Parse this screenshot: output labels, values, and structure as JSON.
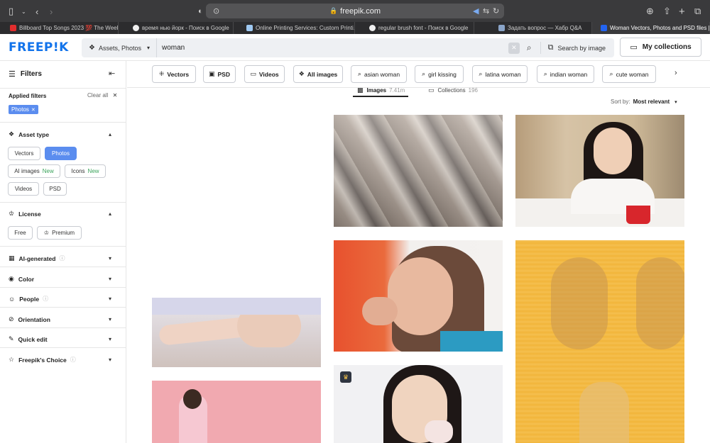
{
  "browser": {
    "url": "freepik.com",
    "tabs": [
      {
        "title": "Billboard Top Songs 2023 💯 The Week...",
        "favicon": "#e12d2d"
      },
      {
        "title": "время нью йорк - Поиск в Google",
        "favicon": "#e8e8e8"
      },
      {
        "title": "Online Printing Services: Custom Printi...",
        "favicon": "#9fc9f2"
      },
      {
        "title": "regular brush font - Поиск в Google",
        "favicon": "#e8e8e8"
      },
      {
        "title": "Задать вопрос — Хабр Q&A",
        "favicon": "#8aa4c8"
      },
      {
        "title": "Woman Vectors, Photos and PSD files |...",
        "favicon": "#2364f0"
      }
    ]
  },
  "header": {
    "logo": "FREEP!K",
    "asset_type": "Assets, Photos",
    "search_value": "woman",
    "search_by_image": "Search by image",
    "my_collections": "My collections"
  },
  "sidebar": {
    "title": "Filters",
    "applied_label": "Applied filters",
    "clear_all": "Clear all",
    "applied_chip": "Photos",
    "asset_type_title": "Asset type",
    "asset_types": [
      "Vectors",
      "Photos",
      "AI images",
      "Icons",
      "Videos",
      "PSD"
    ],
    "new_badge": "New",
    "license_title": "License",
    "license_free": "Free",
    "license_premium": "Premium",
    "ai_generated": "AI-generated",
    "color": "Color",
    "people": "People",
    "orientation": "Orientation",
    "quick_edit": "Quick edit",
    "freepiks_choice": "Freepik's Choice"
  },
  "chips": [
    "Vectors",
    "PSD",
    "Videos",
    "All images",
    "asian woman",
    "girl kissing",
    "latina woman",
    "indian woman",
    "cute woman"
  ],
  "results": {
    "images_tab": "Images",
    "images_count": "7.41m",
    "collections_tab": "Collections",
    "collections_count": "196",
    "sort_label": "Sort by:",
    "sort_value": "Most relevant"
  }
}
